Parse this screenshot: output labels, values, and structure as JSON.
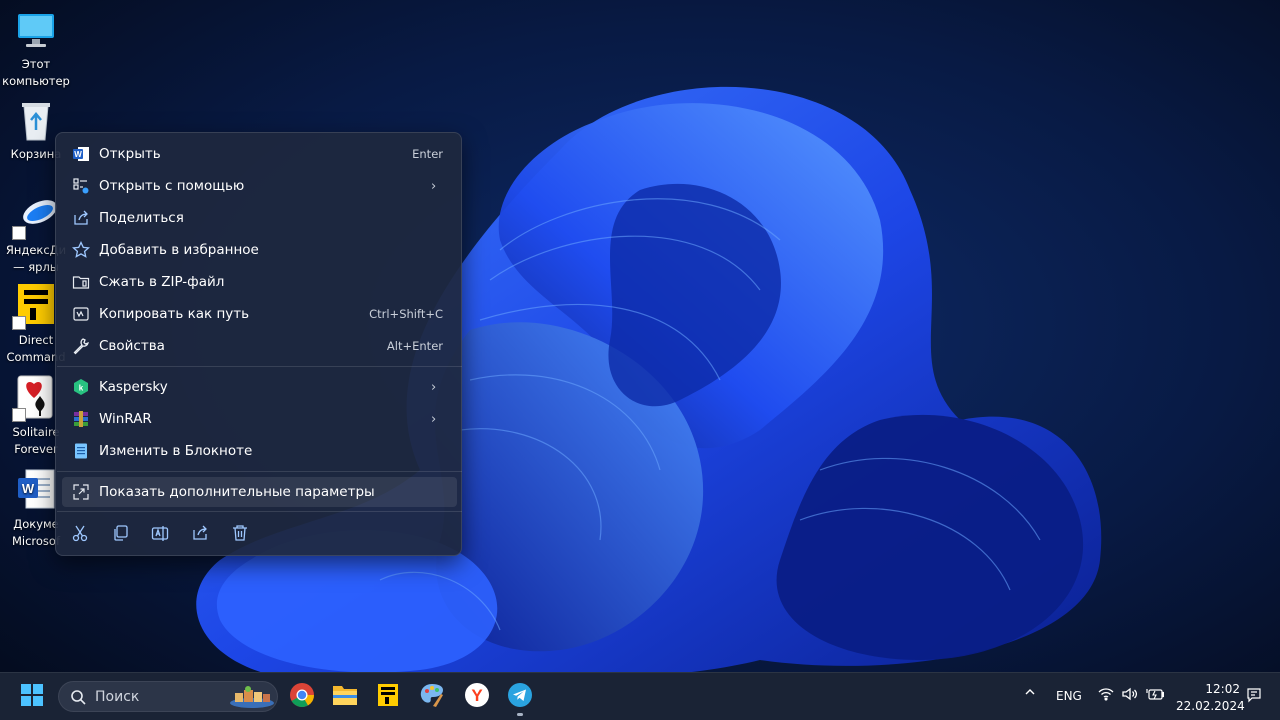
{
  "desktop": {
    "icons": [
      {
        "label_line1": "Этот",
        "label_line2": "компьютер",
        "icon": "monitor-icon"
      },
      {
        "label_line1": "Корзина",
        "label_line2": "",
        "icon": "recycle-bin-icon"
      },
      {
        "label_line1": "ЯндексДи",
        "label_line2": "— ярлы",
        "icon": "yandex-disk-icon"
      },
      {
        "label_line1": "Direct",
        "label_line2": "Command",
        "icon": "direct-commander-icon"
      },
      {
        "label_line1": "Solitaire",
        "label_line2": "Forever",
        "icon": "solitaire-icon"
      },
      {
        "label_line1": "Докуме",
        "label_line2": "Microsof",
        "icon": "word-document-icon"
      }
    ]
  },
  "context_menu": {
    "items": [
      {
        "label": "Открыть",
        "shortcut": "Enter",
        "icon": "word-icon"
      },
      {
        "label": "Открыть с помощью",
        "arrow": "›",
        "icon": "open-with-icon"
      },
      {
        "label": "Поделиться",
        "icon": "share-icon"
      },
      {
        "label": "Добавить в избранное",
        "icon": "star-icon"
      },
      {
        "label": "Сжать в ZIP-файл",
        "icon": "zip-folder-icon"
      },
      {
        "label": "Копировать как путь",
        "shortcut": "Ctrl+Shift+C",
        "icon": "copy-path-icon"
      },
      {
        "label": "Свойства",
        "shortcut": "Alt+Enter",
        "icon": "wrench-icon"
      },
      {
        "label": "Kaspersky",
        "arrow": "›",
        "icon": "kaspersky-icon"
      },
      {
        "label": "WinRAR",
        "arrow": "›",
        "icon": "winrar-icon"
      },
      {
        "label": "Изменить в Блокноте",
        "icon": "notepad-icon"
      },
      {
        "label": "Показать дополнительные параметры",
        "icon": "more-options-icon"
      }
    ],
    "bottom_actions": [
      "cut-icon",
      "copy-icon",
      "rename-icon",
      "share-icon",
      "delete-icon"
    ]
  },
  "taskbar": {
    "search_placeholder": "Поиск",
    "apps": [
      "start-icon",
      "chrome-icon",
      "file-explorer-icon",
      "direct-commander-icon",
      "paint-icon",
      "yandex-browser-icon",
      "telegram-icon"
    ],
    "tray": {
      "chevron": "^",
      "language": "ENG",
      "icons": [
        "wifi-icon",
        "volume-icon",
        "battery-icon",
        "notification-icon"
      ]
    },
    "clock": {
      "time": "12:02",
      "date": "22.02.2024"
    }
  }
}
